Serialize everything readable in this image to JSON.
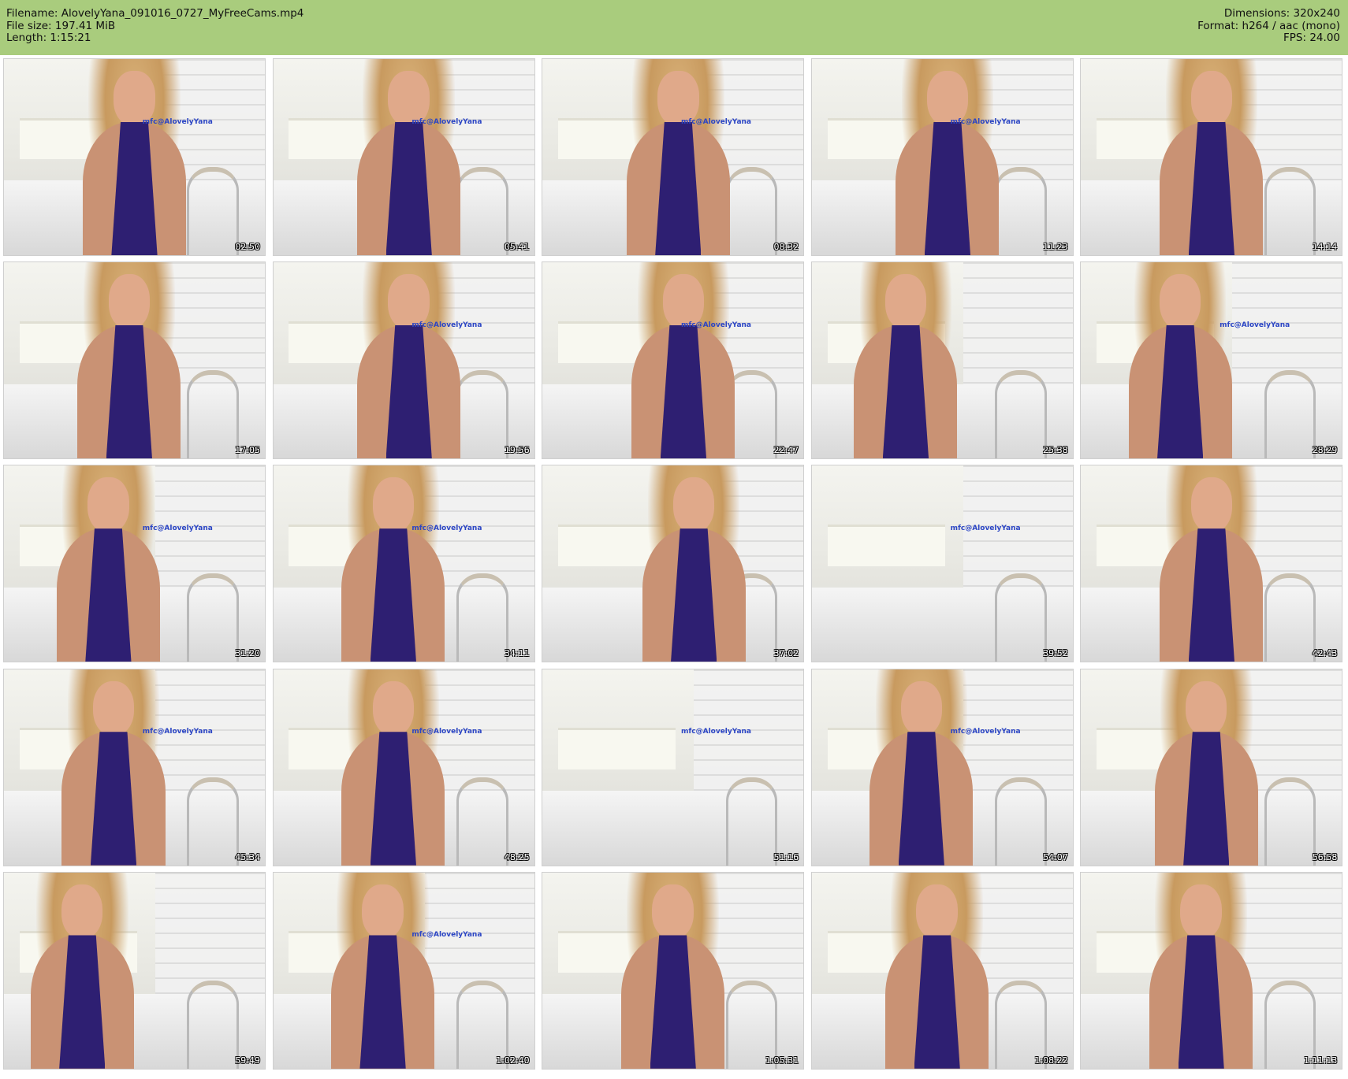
{
  "header": {
    "left": [
      "Filename: AlovelyYana_091016_0727_MyFreeCams.mp4",
      "File size: 197.41 MiB",
      "Length: 1:15:21"
    ],
    "right": [
      "Dimensions: 320x240",
      "Format: h264 / aac (mono)",
      "FPS: 24.00"
    ]
  },
  "watermark": "mfc@AlovelyYana",
  "thumbnails": [
    "02:50",
    "05:41",
    "08:32",
    "11:23",
    "14:14",
    "17:05",
    "19:56",
    "22:47",
    "25:38",
    "28:29",
    "31:20",
    "34:11",
    "37:02",
    "39:52",
    "42:43",
    "45:34",
    "48:25",
    "51:16",
    "54:07",
    "56:58",
    "59:49",
    "1:02:40",
    "1:05:31",
    "1:08:22",
    "1:11:13"
  ],
  "colors": {
    "header_bg": "#a9cc7d",
    "lingerie": "#2e1f72"
  }
}
